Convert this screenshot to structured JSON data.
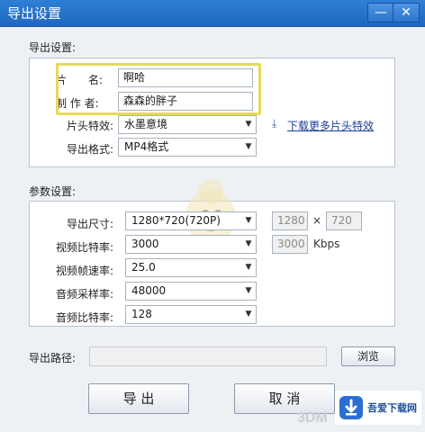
{
  "window": {
    "title": "导出设置",
    "minimize_label": "—",
    "close_label": "✕"
  },
  "export_settings": {
    "section_label": "导出设置:",
    "title_label": "片　　名:",
    "title_value": "啊哈",
    "author_label": "制 作 者:",
    "author_value": "森森的胖子",
    "intro_effect_label": "片头特效:",
    "intro_effect_value": "水墨意境",
    "download_link": "下载更多片头特效",
    "format_label": "导出格式:",
    "format_value": "MP4格式"
  },
  "params": {
    "section_label": "参数设置:",
    "size_label": "导出尺寸:",
    "size_value": "1280*720(720P)",
    "width_value": "1280",
    "times_label": "×",
    "height_value": "720",
    "video_bitrate_label": "视频比特率:",
    "video_bitrate_value": "3000",
    "video_bitrate_custom": "3000",
    "bitrate_unit": "Kbps",
    "framerate_label": "视频帧速率:",
    "framerate_value": "25.0",
    "samplerate_label": "音频采样率:",
    "samplerate_value": "48000",
    "audio_bitrate_label": "音频比特率:",
    "audio_bitrate_value": "128"
  },
  "path": {
    "label": "导出路径:",
    "value": "",
    "browse_label": "浏览"
  },
  "actions": {
    "export_label": "导 出",
    "cancel_label": "取 消"
  },
  "watermark": {
    "logo_text": "吾爱下载网",
    "site_text": "3DM"
  }
}
